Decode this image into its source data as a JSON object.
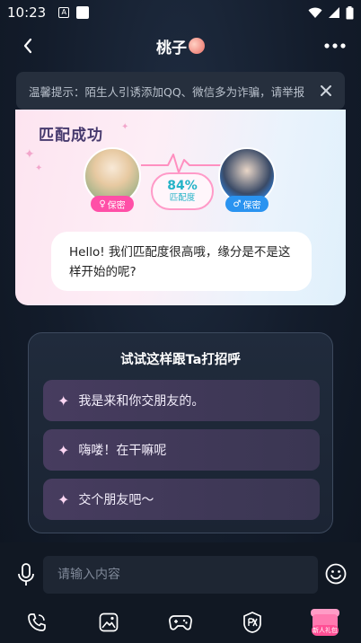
{
  "status_bar": {
    "time": "10:23",
    "badge": "A"
  },
  "header": {
    "title": "桃子"
  },
  "notice": {
    "text": "温馨提示：陌生人引诱添加QQ、微信多为诈骗，请举报"
  },
  "match": {
    "title": "匹配成功",
    "rate_value": "84%",
    "rate_label": "匹配度",
    "left_user_badge": "保密",
    "right_user_badge": "保密",
    "greeting": "Hello! 我们匹配度很高哦，缘分是不是这样开始的呢?"
  },
  "suggestions": {
    "title": "试试这样跟Ta打招呼",
    "items": [
      {
        "label": "我是来和你交朋友的。"
      },
      {
        "label": "嗨喽！在干嘛呢"
      },
      {
        "label": "交个朋友吧～"
      }
    ]
  },
  "input": {
    "placeholder": "请输入内容"
  },
  "tools": {
    "newbie_label": "新人礼包"
  }
}
